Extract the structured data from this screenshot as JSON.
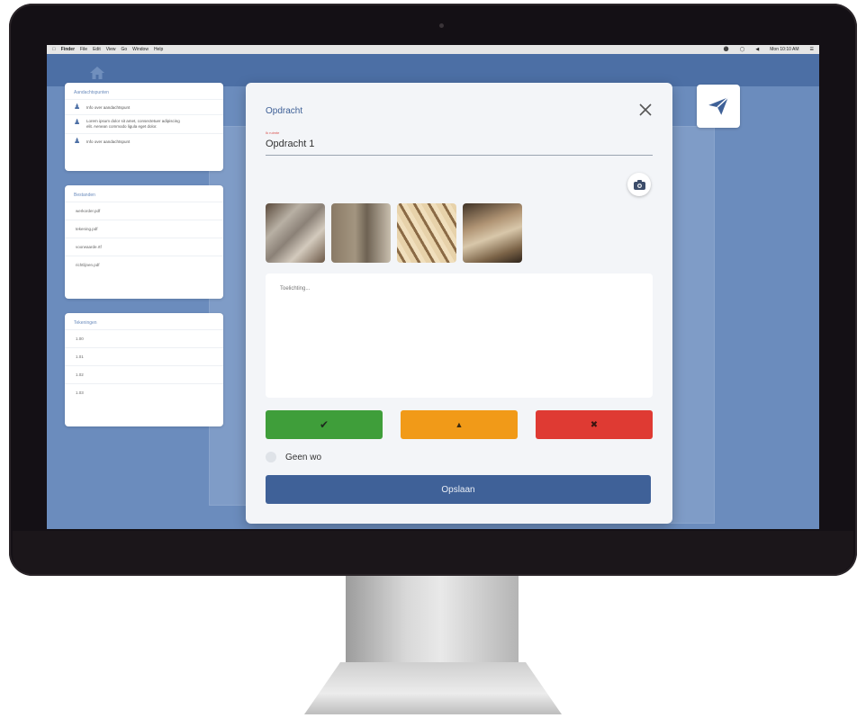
{
  "menubar": {
    "apple": "",
    "items": [
      "Finder",
      "File",
      "Edit",
      "View",
      "Go",
      "Window",
      "Help"
    ],
    "right": [
      "⚫",
      "◯",
      "◀",
      "Mon 10:10 AM",
      "☰"
    ]
  },
  "sidebar": {
    "info_card": {
      "title": "Aandachtspunten",
      "rows": [
        {
          "text": "Info over aandachtspunt",
          "icon": "person-icon"
        },
        {
          "text": "Lorem ipsum dolor sit amet, consectetuer adipiscing elit. Aenean commodo ligula eget dolor.",
          "icon": "person-icon"
        },
        {
          "text": "Info over aandachtspunt",
          "icon": "person-icon"
        }
      ]
    },
    "files_card": {
      "title": "Bestanden",
      "items": [
        "werkorder.pdf",
        "tekening.pdf",
        "voorwaarde.rtf",
        "richtlijnen.pdf"
      ]
    },
    "drawings_card": {
      "title": "Tekeningen",
      "items": [
        "1.00",
        "1.01",
        "1.02",
        "1.03"
      ]
    }
  },
  "modal": {
    "title": "Opdracht",
    "field_label": "Ik ruimte",
    "field_value": "Opdracht 1",
    "notes_placeholder": "Toelichting...",
    "status_buttons": {
      "ok_icon": "✔",
      "warning_icon": "▲",
      "fail_icon": "✖"
    },
    "radio_label": "Geen wo",
    "upload_label": "Opslaan"
  },
  "colors": {
    "primary": "#3f6198",
    "background": "#6b8cbd",
    "ok": "#3f9e3a",
    "warning": "#f19a18",
    "fail": "#df3a33"
  }
}
